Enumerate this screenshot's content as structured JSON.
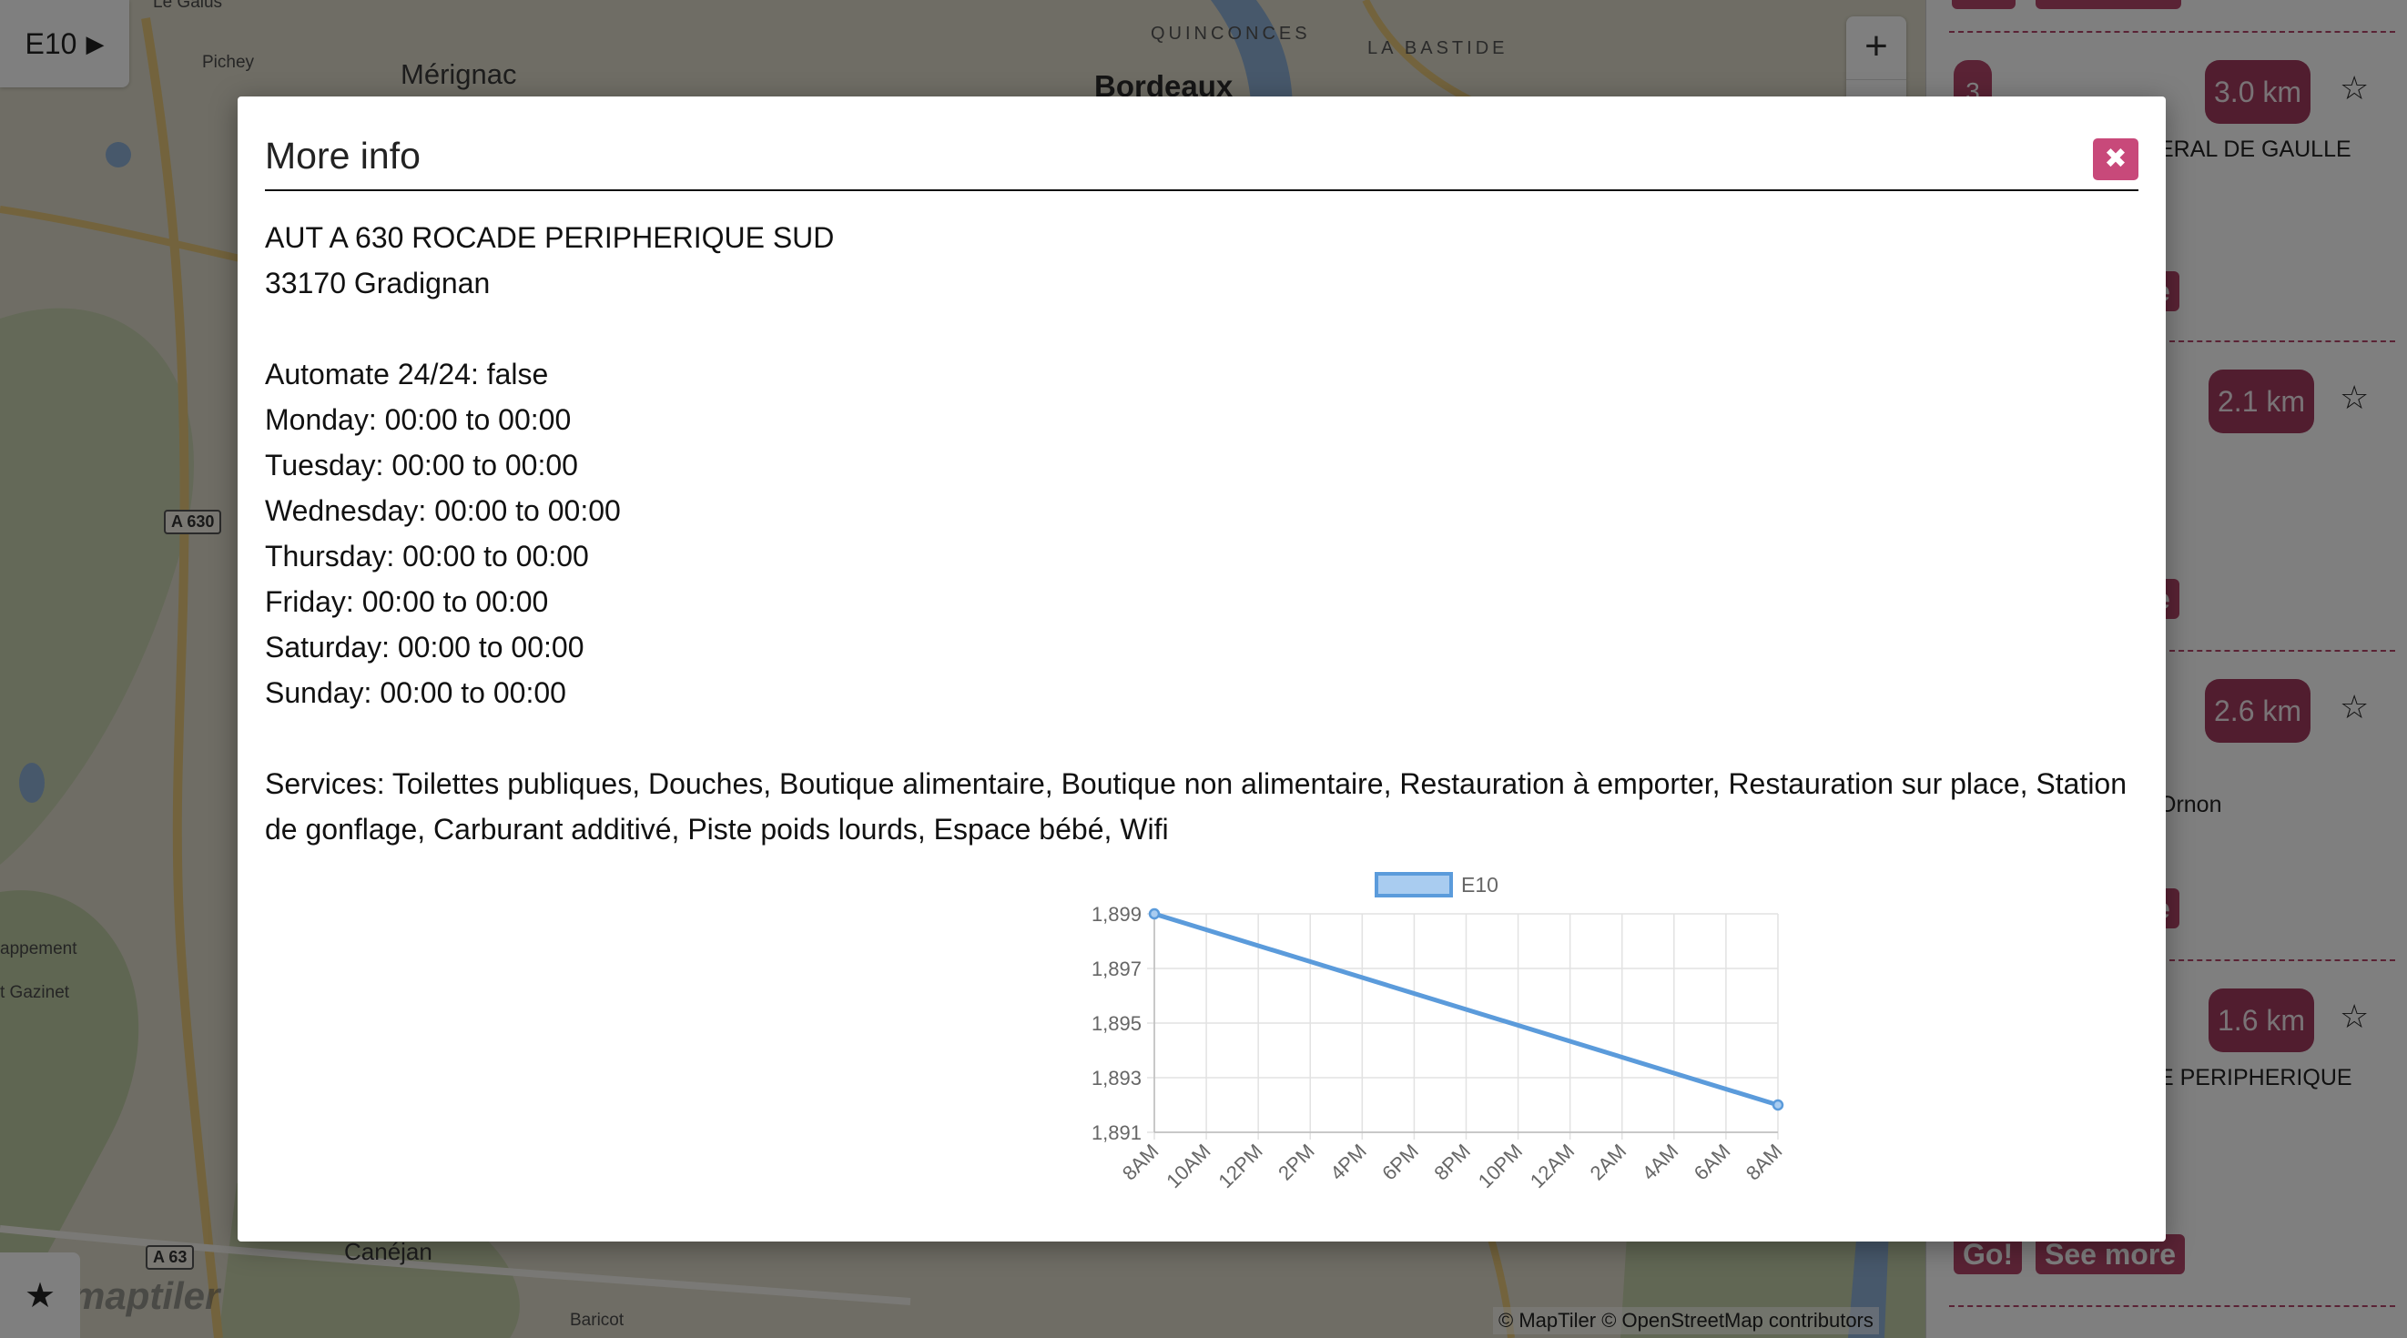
{
  "map": {
    "fuel_selector": {
      "label": "E10",
      "icon": "play-triangle-icon"
    },
    "zoom_in_label": "+",
    "favorites_icon": "star-filled-icon",
    "logo_text": "maptiler",
    "attribution": "© MapTiler © OpenStreetMap contributors",
    "places": [
      "Le Galus",
      "Pichey",
      "Mérignac",
      "Bordeaux",
      "QUINCONCES",
      "LA BASTIDE",
      "appement",
      "t Gazinet",
      "Canéjan",
      "Baricot"
    ],
    "road_shields": [
      "A 630",
      "A 63"
    ]
  },
  "stations": [
    {
      "number": "3",
      "distance": "3.0 km",
      "address": "ERAL DE GAULLE",
      "action_label": "e"
    },
    {
      "distance": "2.1 km",
      "action_label": "e"
    },
    {
      "distance": "2.6 km",
      "address": "Ornon",
      "action_label": "e"
    },
    {
      "distance": "1.6 km",
      "address": "E PERIPHERIQUE",
      "go_label": "Go!",
      "see_more_label": "See more"
    }
  ],
  "modal": {
    "title": "More info",
    "close_icon": "close-x-icon",
    "address_line1": "AUT A 630 ROCADE PERIPHERIQUE SUD",
    "address_line2": "33170 Gradignan",
    "automate": "Automate 24/24: false",
    "hours": [
      "Monday: 00:00 to 00:00",
      "Tuesday: 00:00 to 00:00",
      "Wednesday: 00:00 to 00:00",
      "Thursday: 00:00 to 00:00",
      "Friday: 00:00 to 00:00",
      "Saturday: 00:00 to 00:00",
      "Sunday: 00:00 to 00:00"
    ],
    "services": "Services: Toilettes publiques, Douches, Boutique alimentaire, Boutique non alimentaire, Restauration à emporter, Restauration sur place, Station de gonflage, Carburant additivé, Piste poids lourds, Espace bébé, Wifi"
  },
  "chart_data": {
    "type": "line",
    "x": [
      "8AM",
      "10AM",
      "12PM",
      "2PM",
      "4PM",
      "6PM",
      "8PM",
      "10PM",
      "12AM",
      "2AM",
      "4AM",
      "6AM",
      "8AM"
    ],
    "series": [
      {
        "name": "E10",
        "points": [
          {
            "x": "8AM",
            "y": 1.899
          },
          {
            "x": "8AM",
            "y": 1.892
          }
        ],
        "color": "#5b9bdb"
      }
    ],
    "ylim": [
      1.891,
      1.899
    ],
    "yticks": [
      "1,899",
      "1,897",
      "1,895",
      "1,893",
      "1,891"
    ],
    "xlabel": "",
    "ylabel": "",
    "grid": true,
    "legend": "top"
  }
}
